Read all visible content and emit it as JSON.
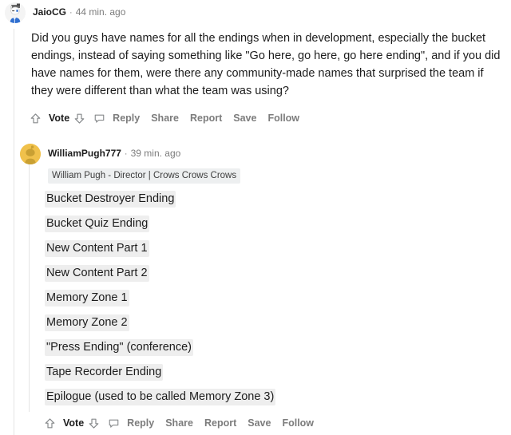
{
  "colors": {
    "text": "#1c1c1c",
    "muted": "#7c7c7c",
    "code_bg": "#eeeeee",
    "flair_bg": "#edeff0",
    "rail": "#e4e4e4",
    "avatar_gold": "#f0c14b"
  },
  "comments": [
    {
      "author": "JaioCG",
      "separator": "·",
      "timestamp": "44 min. ago",
      "avatar": "snoo-avatar-camera-headset",
      "body": "Did you guys have names for all the endings when in development, especially the bucket endings, instead of saying something like \"Go here, go here, go here ending\", and if you did have names for them, were there any community-made names that surprised the team if they were different than what the team was using?",
      "actions": {
        "upvote_icon": "upvote-arrow-icon",
        "vote_label": "Vote",
        "downvote_icon": "downvote-arrow-icon",
        "comment_icon": "comment-bubble-icon",
        "reply_label": "Reply",
        "share_label": "Share",
        "report_label": "Report",
        "save_label": "Save",
        "follow_label": "Follow"
      }
    },
    {
      "author": "WilliamPugh777",
      "separator": "·",
      "timestamp": "39 min. ago",
      "avatar": "snoo-avatar-gold",
      "flair": "William Pugh - Director | Crows Crows Crows",
      "code_lines": [
        "Bucket Destroyer Ending",
        "Bucket Quiz Ending",
        "New Content Part 1",
        "New Content Part 2",
        "Memory Zone 1",
        "Memory Zone 2",
        "\"Press Ending\" (conference)",
        "Tape Recorder Ending",
        "Epilogue (used to be called Memory Zone 3)"
      ],
      "actions": {
        "upvote_icon": "upvote-arrow-icon",
        "vote_label": "Vote",
        "downvote_icon": "downvote-arrow-icon",
        "comment_icon": "comment-bubble-icon",
        "reply_label": "Reply",
        "share_label": "Share",
        "report_label": "Report",
        "save_label": "Save",
        "follow_label": "Follow"
      }
    }
  ]
}
